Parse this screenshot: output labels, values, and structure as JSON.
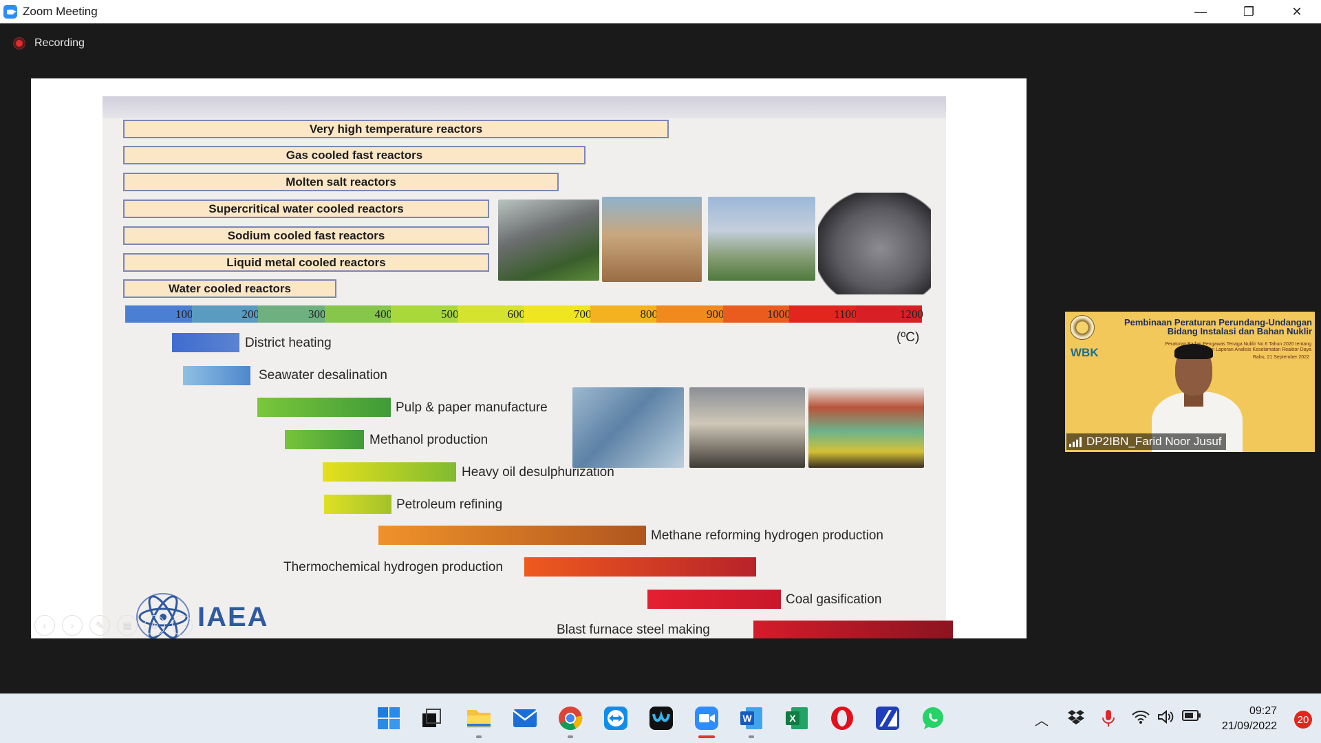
{
  "window": {
    "title": "Zoom Meeting",
    "minimize": "—",
    "restore": "❐",
    "close": "✕"
  },
  "recording": {
    "label": "Recording"
  },
  "slide": {
    "reactors": [
      "Very high temperature reactors",
      "Gas cooled fast reactors",
      "Molten salt reactors",
      "Supercritical water cooled reactors",
      "Sodium cooled fast reactors",
      "Liquid metal cooled reactors",
      "Water cooled reactors"
    ],
    "scale": [
      "100",
      "200",
      "300",
      "400",
      "500",
      "600",
      "700",
      "800",
      "900",
      "1000",
      "1100",
      "1200"
    ],
    "unit": "(ºC)",
    "applications": [
      "District heating",
      "Seawater desalination",
      "Pulp & paper manufacture",
      "Methanol production",
      "Heavy oil desulphurization",
      "Petroleum refining",
      "Methane reforming hydrogen production",
      "Thermochemical hydrogen production",
      "Coal gasification",
      "Blast furnace steel making"
    ],
    "logo_text": "IAEA"
  },
  "video": {
    "title_line1": "Pembinaan Peraturan Perundang-Undangan",
    "title_line2": "Bidang Instalasi dan Bahan Nuklir",
    "subtitle_line1": "Peraturan Badan Pengawas Tenaga Nuklir No 6 Tahun 2020 tentang",
    "subtitle_line2": "Penyusunan Laporan Analisis Keselamatan Reaktor Daya",
    "date": "Rabu, 21 September 2022",
    "wbk": "WBK",
    "participant_name": "DP2IBN_Farid Noor Jusuf"
  },
  "taskbar": {
    "time": "09:27",
    "date": "21/09/2022",
    "notifications": "20",
    "apps": [
      "start-icon",
      "task-view-icon",
      "file-explorer-icon",
      "mail-icon",
      "chrome-icon",
      "teamviewer-icon",
      "webex-icon",
      "zoom-icon",
      "word-icon",
      "excel-icon",
      "opera-icon",
      "app-icon",
      "whatsapp-icon"
    ]
  }
}
